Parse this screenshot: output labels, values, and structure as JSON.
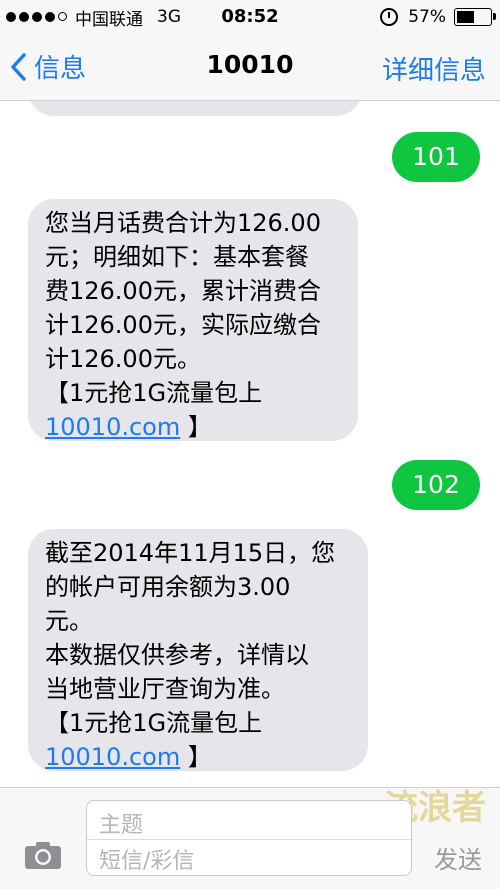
{
  "status_bar": {
    "carrier": "中国联通",
    "network": "3G",
    "time": "08:52",
    "battery": "57%",
    "battery_level": 0.57
  },
  "nav": {
    "back_label": "信息",
    "title": "10010",
    "details_label": "详细信息"
  },
  "messages": [
    {
      "direction": "outgoing",
      "text": "101"
    },
    {
      "direction": "incoming",
      "lines": [
        "您当月话费合计为126.00",
        "元；明细如下：基本套餐",
        "费126.00元，累计消费合",
        "计126.00元，实际应缴合",
        "计126.00元。",
        " 【1元抢1G流量包上"
      ],
      "link": "10010.com",
      "tail": " 】"
    },
    {
      "direction": "outgoing",
      "text": "102"
    },
    {
      "direction": "incoming",
      "lines": [
        "截至2014年11月15日，您",
        "的帐户可用余额为3.00",
        "元。",
        " 本数据仅供参考，详情以",
        "当地营业厅查询为准。",
        " 【1元抢1G流量包上"
      ],
      "link": "10010.com",
      "tail": " 】"
    }
  ],
  "input_bar": {
    "subject_placeholder": "主题",
    "body_placeholder": "短信/彩信",
    "send_label": "发送",
    "watermark": "流浪者"
  },
  "colors": {
    "accent": "#1a7cf5",
    "outgoing_bubble": "#0ec640",
    "incoming_bubble": "#e5e5ea"
  }
}
